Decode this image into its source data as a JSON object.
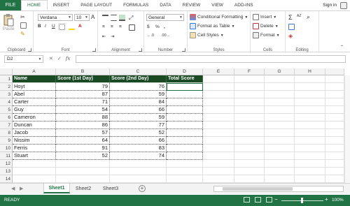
{
  "tabs": {
    "file": "FILE",
    "items": [
      "HOME",
      "INSERT",
      "PAGE LAYOUT",
      "FORMULAS",
      "DATA",
      "REVIEW",
      "VIEW",
      "ADD-INS"
    ],
    "active": "HOME",
    "sign_in": "Sign in"
  },
  "ribbon": {
    "clipboard": {
      "label": "Clipboard",
      "paste": "Paste"
    },
    "font": {
      "label": "Font",
      "name": "Verdana",
      "size": "10",
      "bold": "B",
      "italic": "I",
      "underline": "U",
      "grow": "A",
      "shrink": "A",
      "color_letter": "A"
    },
    "alignment": {
      "label": "Alignment"
    },
    "number": {
      "label": "Number",
      "format": "General",
      "currency": "$",
      "percent": "%",
      "comma": ",",
      "inc_dec": "←.0",
      "dec_dec": ".00→"
    },
    "styles": {
      "label": "Styles",
      "conditional": "Conditional Formatting",
      "table": "Format as Table",
      "cell_styles": "Cell Styles"
    },
    "cells": {
      "label": "Cells",
      "insert": "Insert",
      "delete": "Delete",
      "format": "Format"
    },
    "editing": {
      "label": "Editing",
      "sigma": "Σ",
      "sort": "AZ",
      "find": "⌕"
    }
  },
  "formula_bar": {
    "name_box": "D2",
    "cancel": "✕",
    "enter": "✓",
    "fx": "fx",
    "value": ""
  },
  "columns": [
    "A",
    "B",
    "C",
    "D",
    "E",
    "F",
    "G",
    "H"
  ],
  "rows": [
    "1",
    "2",
    "3",
    "4",
    "5",
    "6",
    "7",
    "8",
    "9",
    "10",
    "11",
    "12",
    "13",
    "14"
  ],
  "table": {
    "headers": [
      "Name",
      "Score (1st Day)",
      "Score (2nd Day)",
      "Total Score"
    ],
    "data": [
      [
        "Hoyt",
        "79",
        "76",
        ""
      ],
      [
        "Abel",
        "87",
        "59",
        ""
      ],
      [
        "Carter",
        "71",
        "84",
        ""
      ],
      [
        "Guy",
        "54",
        "66",
        ""
      ],
      [
        "Cameron",
        "88",
        "59",
        ""
      ],
      [
        "Duncan",
        "86",
        "77",
        ""
      ],
      [
        "Jacob",
        "57",
        "52",
        ""
      ],
      [
        "Nissim",
        "64",
        "66",
        ""
      ],
      [
        "Ferris",
        "91",
        "83",
        ""
      ],
      [
        "Stuart",
        "52",
        "74",
        ""
      ]
    ]
  },
  "sheets": {
    "tabs": [
      "Sheet1",
      "Sheet2",
      "Sheet3"
    ],
    "active": "Sheet1",
    "add": "+"
  },
  "status": {
    "ready": "READY",
    "zoom": "100%",
    "zoom_minus": "−",
    "zoom_plus": "+"
  },
  "colors": {
    "accent": "#217346",
    "header_fill": "#1a4a23"
  }
}
